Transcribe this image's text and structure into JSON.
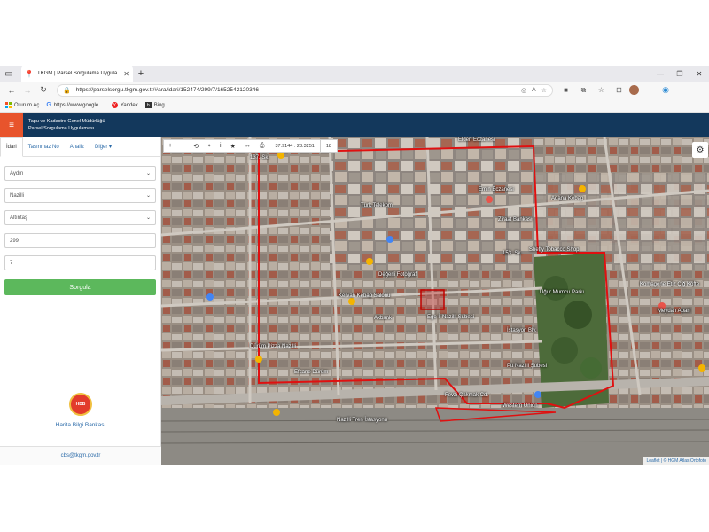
{
  "browser": {
    "tab_title": "TKGM | Parsel Sorgulama Uygula",
    "url": "https://parselsorgu.tkgm.gov.tr/#ara/idari/152474/299/7/1652542120346",
    "bookmarks": [
      "Oturum Aç",
      "https://www.google....",
      "Yandex",
      "Bing"
    ]
  },
  "app": {
    "title_line1": "Tapu ve Kadastro Genel Müdürlüğü",
    "title_line2": "Parsel Sorgulama Uygulaması"
  },
  "panel": {
    "tabs": [
      "İdari",
      "Taşınmaz No",
      "Analiz",
      "Diğer"
    ],
    "province": "Aydın",
    "district": "Nazilli",
    "neighborhood": "Altıntaş",
    "block": "299",
    "parcel": "7",
    "submit_label": "Sorgula",
    "bank_label": "Harita Bilgi Bankası",
    "footer_email": "cbs@tkgm.gov.tr"
  },
  "map": {
    "coordinate": "37.9144 : 28.3251",
    "zoom": "18",
    "attribution": "Leaflet | © HGM Atlas Ortofoto",
    "labels": [
      "Elden Eczanesi",
      "Emin Eczanesi",
      "Adana Kebap",
      "Ziraat Bankası",
      "Sheffy Tobacco Shop",
      "Uğur Mumcu Parkı",
      "Kervan Kebap Salonu",
      "Akbank",
      "Ege İl Nazilli Şubesi",
      "Türk Telekom",
      "Değerli Fotoğraf",
      "Fevzi Çakmak Cd.",
      "Western Union",
      "Nazilli Tren İstasyonu",
      "İstasyon Blv.",
      "Ptt Nazilli Şubesi",
      "Komagene Etiz Çiğ Köfte",
      "Meydan Apart",
      "Efsane Dürüm",
      "Dürüm Pizza Nazilli",
      "153. Sk.",
      "137. Sk."
    ]
  },
  "colors": {
    "header_bg": "#13385c",
    "accent": "#e8542c",
    "button_green": "#5cb85c",
    "parcel_outline": "#e01010"
  },
  "icons": [
    "hamburger-icon",
    "gear-icon",
    "zoom-in-icon",
    "zoom-out-icon",
    "refresh-icon",
    "locate-icon",
    "info-icon",
    "star-icon",
    "measure-icon",
    "print-icon"
  ]
}
